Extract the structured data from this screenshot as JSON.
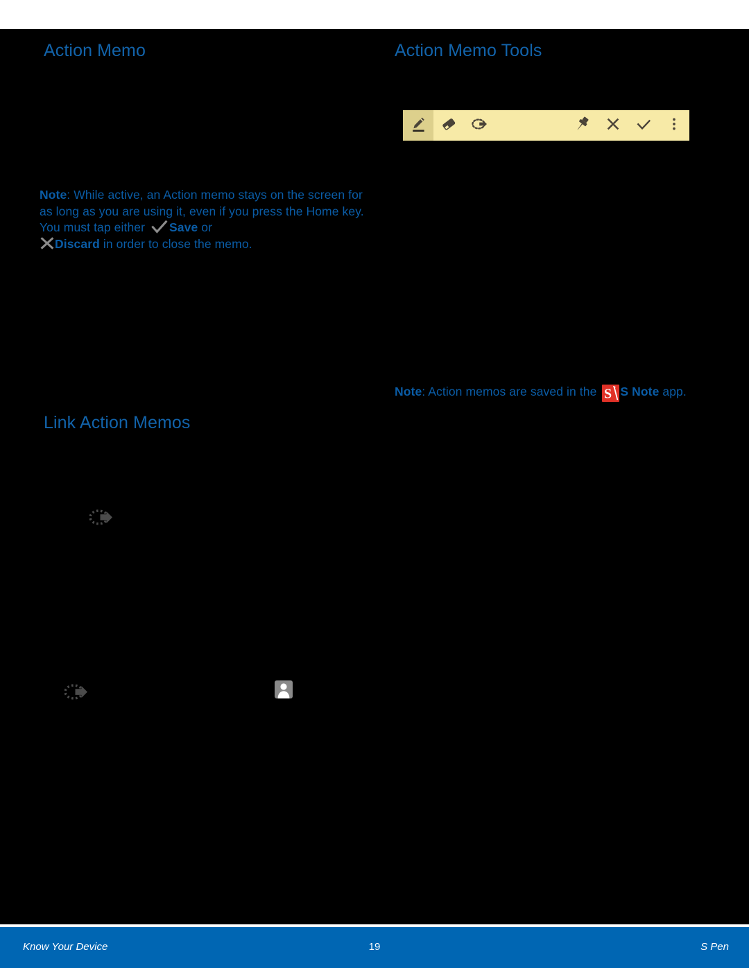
{
  "page": {
    "background_color": "#000000",
    "heading_color": "#1263aa",
    "note_color": "#0a5ca6",
    "footer_color": "#0066b3"
  },
  "headings": {
    "action_memo": "Action Memo",
    "action_memo_tools": "Action Memo Tools",
    "link_action_memos": "Link Action Memos"
  },
  "note_left": {
    "label": "Note",
    "colon": ": ",
    "part1": "While active, an Action memo stays on the screen for as long as you are using it, even if you press the Home key. You must tap either ",
    "save_label": "Save",
    "part2": " or ",
    "discard_label": "Discard",
    "part3": " in order to close the memo.",
    "check_icon": "check-icon",
    "x_icon": "close-icon"
  },
  "note_right": {
    "label": "Note",
    "colon": ": ",
    "part1": "Action memos are saved in the ",
    "app_icon": "s-note-icon",
    "app_icon_letter": "S",
    "app_icon_color": "#e03127",
    "app_label": "S Note",
    "part2": " app."
  },
  "toolbar": {
    "name": "action-memo-toolbar",
    "background_color": "#f7eaa7",
    "selected_background_color": "#ddd08c",
    "items": [
      {
        "name": "pen-tool-button",
        "icon": "pen-icon",
        "selected": true
      },
      {
        "name": "eraser-tool-button",
        "icon": "eraser-icon",
        "selected": false
      },
      {
        "name": "link-action-button",
        "icon": "link-action-icon",
        "selected": false
      },
      {
        "name": "pin-button",
        "icon": "pin-icon",
        "selected": false
      },
      {
        "name": "discard-button",
        "icon": "close-icon",
        "selected": false
      },
      {
        "name": "save-button",
        "icon": "check-icon",
        "selected": false
      },
      {
        "name": "more-options-button",
        "icon": "overflow-menu-icon",
        "selected": false
      }
    ]
  },
  "standalone_icons": [
    {
      "name": "link-action-icon",
      "color": "#4a4a4a"
    },
    {
      "name": "link-action-icon",
      "color": "#4a4a4a"
    },
    {
      "name": "contact-icon",
      "color": "#8a8a8a"
    }
  ],
  "footer": {
    "left": "Know Your Device",
    "page_number": "19",
    "right": "S Pen"
  }
}
